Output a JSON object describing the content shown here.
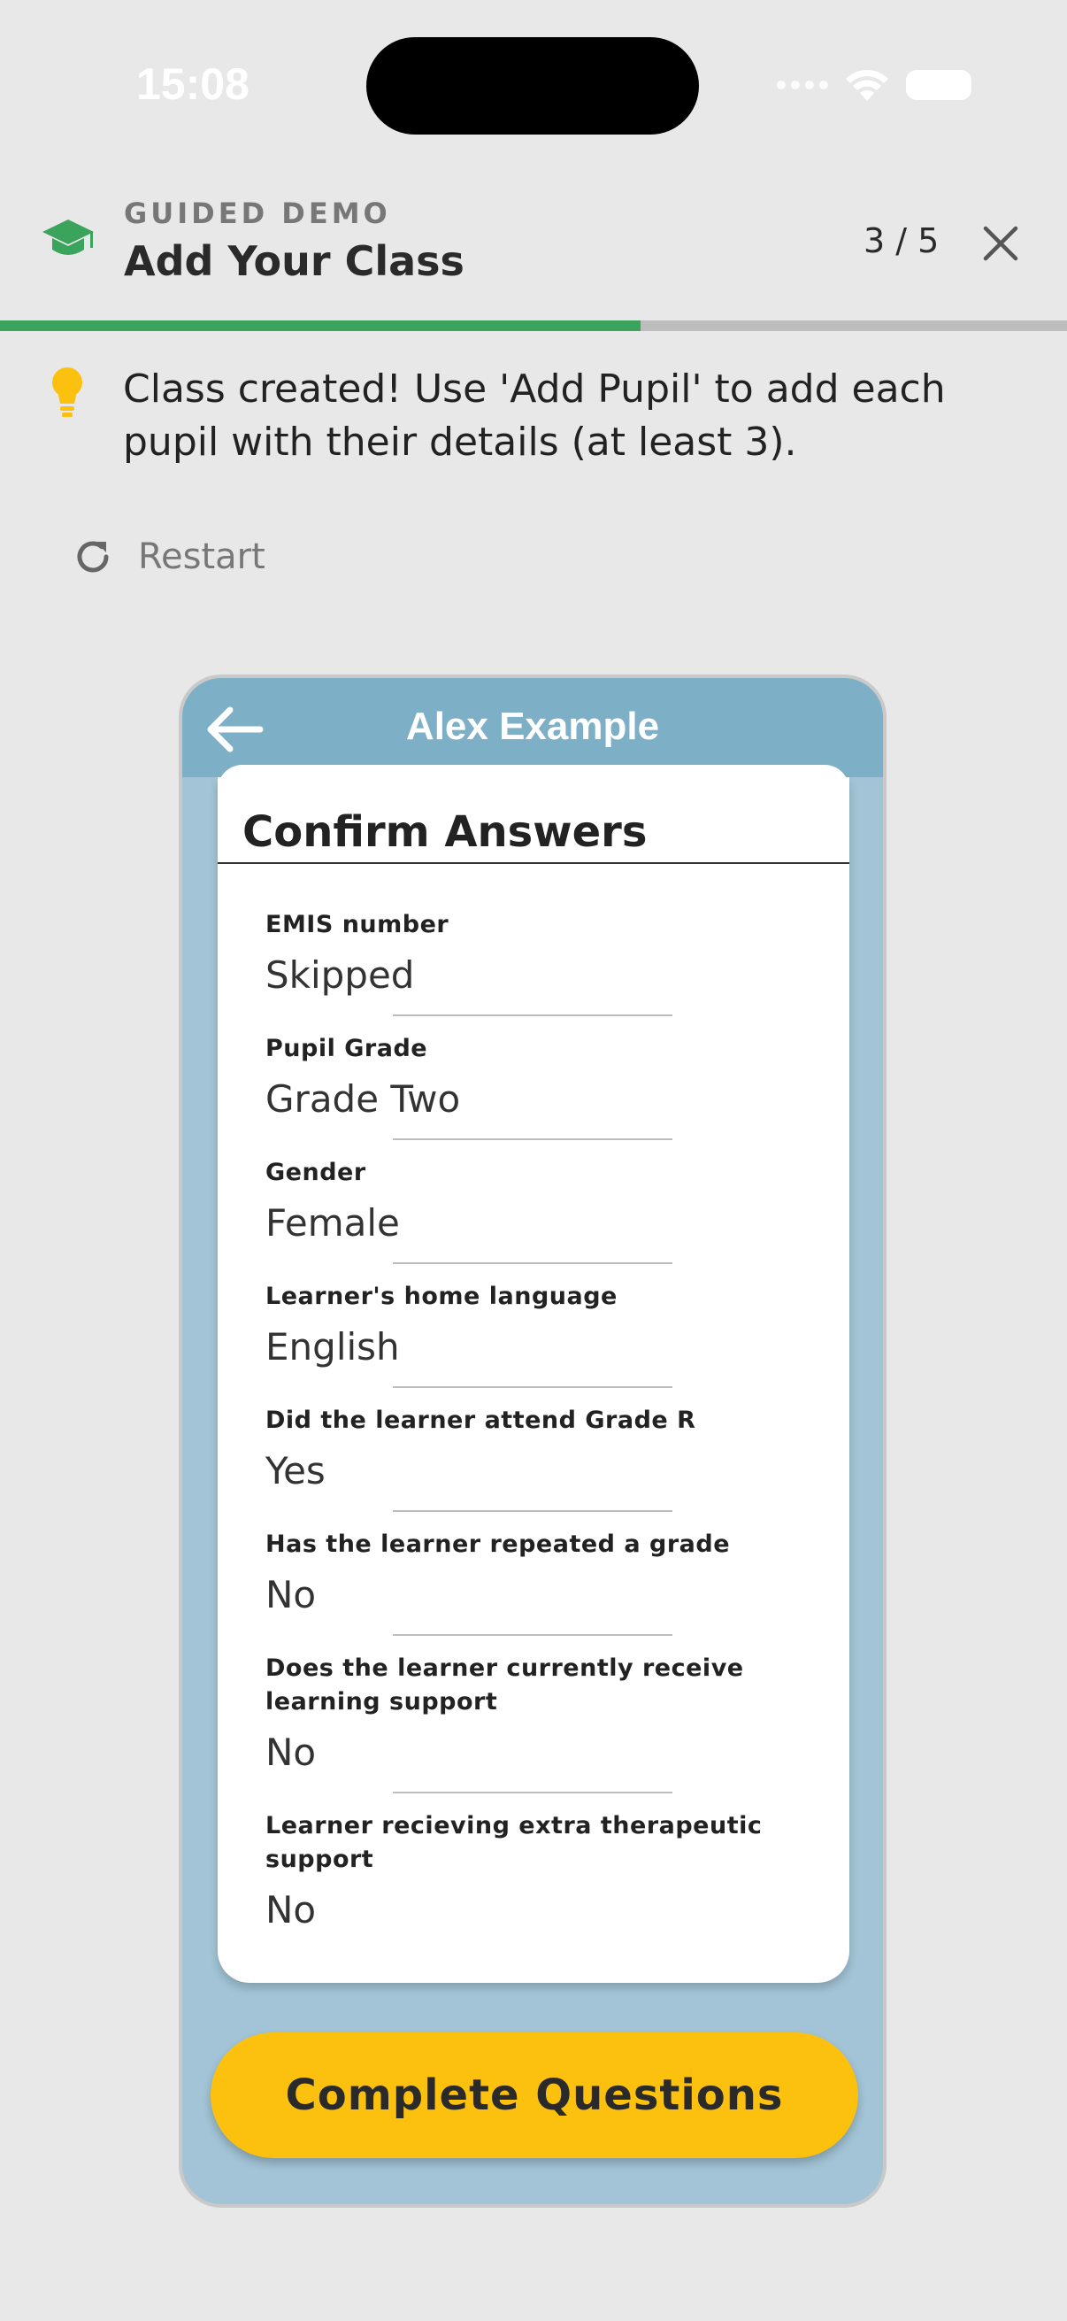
{
  "status_bar": {
    "time": "15:08"
  },
  "demo": {
    "eyebrow": "GUIDED DEMO",
    "title": "Add Your Class",
    "step": "3 / 5",
    "progress": 0.6,
    "tip": "Class created! Use 'Add Pupil' to add each pupil with their details (at least 3).",
    "restart_label": "Restart"
  },
  "colors": {
    "progress_green": "#3aa35c",
    "accent_yellow": "#fcc10f",
    "phone_bg": "#a2c4d6",
    "phone_header": "#7dafc7"
  },
  "phone": {
    "title": "Alex Example",
    "card_title": "Confirm Answers",
    "answers": [
      {
        "question": "EMIS number",
        "answer": "Skipped"
      },
      {
        "question": "Pupil Grade",
        "answer": "Grade Two"
      },
      {
        "question": "Gender",
        "answer": "Female"
      },
      {
        "question": "Learner's home language",
        "answer": "English"
      },
      {
        "question": "Did the learner attend Grade R",
        "answer": "Yes"
      },
      {
        "question": "Has the learner repeated a grade",
        "answer": "No"
      },
      {
        "question": "Does the learner currently receive learning support",
        "answer": "No"
      },
      {
        "question": "Learner recieving extra therapeutic support",
        "answer": "No"
      }
    ],
    "complete_button": "Complete Questions"
  }
}
